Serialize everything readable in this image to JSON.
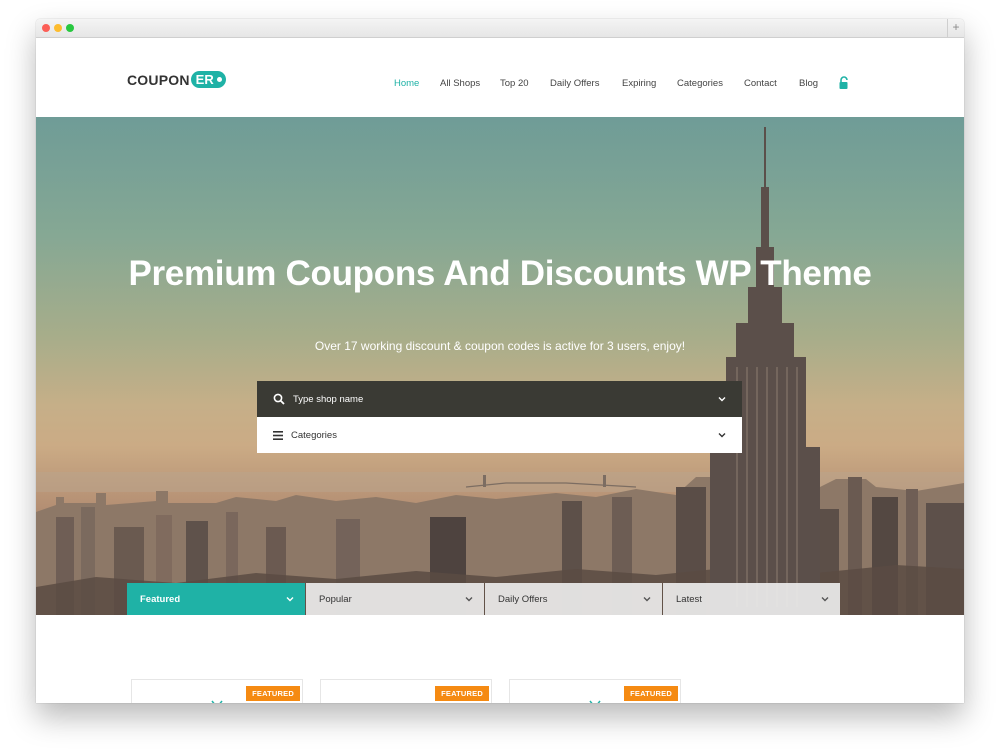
{
  "brand": {
    "name_main": "COUPON",
    "name_accent": "ER",
    "accent_color": "#1fb2a6"
  },
  "nav": {
    "items": [
      "Home",
      "All Shops",
      "Top 20",
      "Daily Offers",
      "Expiring",
      "Categories",
      "Contact",
      "Blog"
    ],
    "active": "Home",
    "lock_icon": "unlock-icon"
  },
  "hero": {
    "title": "Premium Coupons And Discounts WP Theme",
    "subtitle": "Over 17 working discount & coupon codes is active for 3 users, enjoy!",
    "search_placeholder": "Type shop name",
    "categories_label": "Categories"
  },
  "tabs": [
    {
      "label": "Featured",
      "active": true
    },
    {
      "label": "Popular",
      "active": false
    },
    {
      "label": "Daily Offers",
      "active": false
    },
    {
      "label": "Latest",
      "active": false
    }
  ],
  "cards": [
    {
      "badge": "FEATURED",
      "icon": "tv-icon"
    },
    {
      "badge": "FEATURED",
      "icon": "megaphone-icon"
    },
    {
      "badge": "FEATURED",
      "icon": "tv-icon"
    }
  ],
  "colors": {
    "badge": "#f58a12",
    "search_bar": "#3a3a34"
  }
}
